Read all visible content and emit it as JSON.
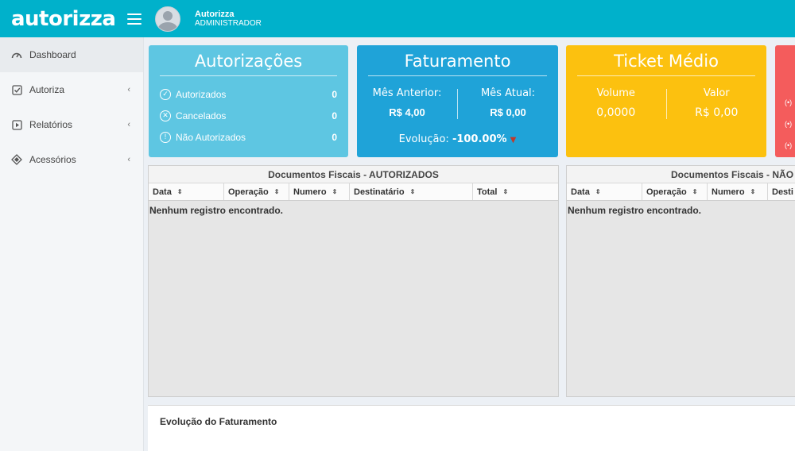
{
  "header": {
    "logo": "autorizza",
    "user_name": "Autorizza",
    "user_role": "ADMINISTRADOR"
  },
  "sidebar": {
    "items": [
      {
        "label": "Dashboard",
        "icon": "dashboard-icon",
        "active": true
      },
      {
        "label": "Autoriza",
        "icon": "check-square-icon"
      },
      {
        "label": "Relatórios",
        "icon": "play-square-icon"
      },
      {
        "label": "Acessórios",
        "icon": "diamond-icon"
      }
    ]
  },
  "cards": {
    "autorizacoes": {
      "title": "Autorizações",
      "rows": [
        {
          "label": "Autorizados",
          "value": "0"
        },
        {
          "label": "Cancelados",
          "value": "0"
        },
        {
          "label": "Não Autorizados",
          "value": "0"
        }
      ]
    },
    "faturamento": {
      "title": "Faturamento",
      "prev_label": "Mês Anterior:",
      "prev_value": "R$ 4,00",
      "curr_label": "Mês Atual:",
      "curr_value": "R$ 0,00",
      "evolution_label": "Evolução:",
      "evolution_value": "-100.00%"
    },
    "ticket": {
      "title": "Ticket Médio",
      "volume_label": "Volume",
      "volume_value": "0,0000",
      "valor_label": "Valor",
      "valor_value": "R$ 0,00"
    }
  },
  "tables": {
    "autorizados": {
      "title": "Documentos Fiscais - AUTORIZADOS",
      "columns": [
        "Data",
        "Operação",
        "Numero",
        "Destinatário",
        "Total"
      ],
      "empty": "Nenhum registro encontrado."
    },
    "nao_autorizados": {
      "title": "Documentos Fiscais - NÃO",
      "columns": [
        "Data",
        "Operação",
        "Numero",
        "Desti"
      ],
      "empty": "Nenhum registro encontrado."
    }
  },
  "bottom": {
    "title": "Evolução do Faturamento"
  },
  "colors": {
    "header": "#00b1cb",
    "card_auth": "#5ec6e2",
    "card_fat": "#1fa3d8",
    "card_ticket": "#fcc10f",
    "card_red": "#f45c5c"
  }
}
